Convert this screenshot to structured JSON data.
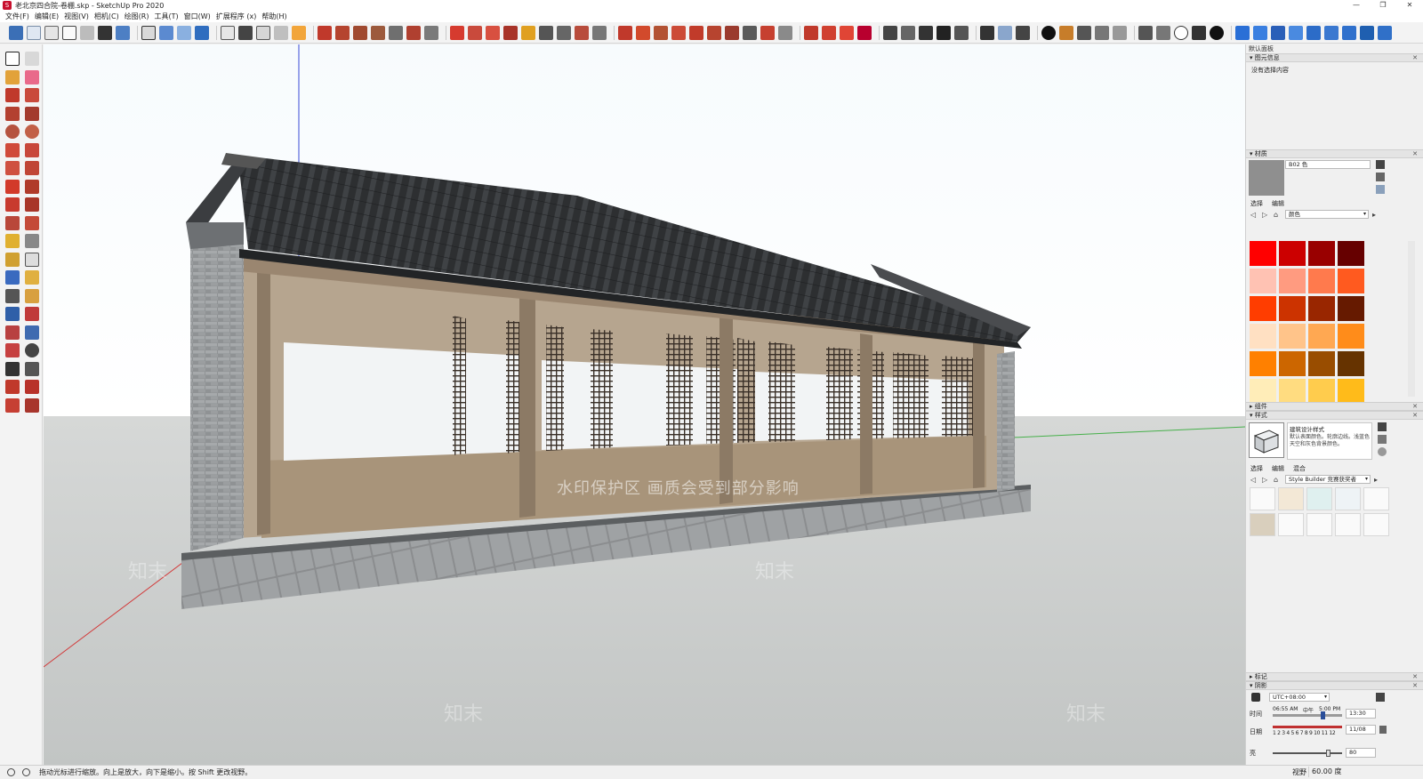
{
  "window": {
    "title": "老北京四合院-卷棚.skp - SketchUp Pro 2020",
    "controls": [
      "—",
      "❐",
      "✕"
    ]
  },
  "menu": [
    "文件(F)",
    "编辑(E)",
    "视图(V)",
    "相机(C)",
    "绘图(R)",
    "工具(T)",
    "窗口(W)",
    "扩展程序 (x)",
    "帮助(H)"
  ],
  "viewport": {
    "watermark_text": "水印保护区  画质会受到部分影响",
    "watermark_logo": "知末"
  },
  "tray": {
    "title": "默认面板",
    "entity_info": {
      "header": "图元信息",
      "message": "没有选择内容"
    },
    "materials": {
      "header": "材质",
      "current_name": "B02 色",
      "tabs": [
        "选择",
        "编辑"
      ],
      "library": "颜色",
      "swatches": [
        "#ff0000",
        "#cc0000",
        "#990000",
        "#660000",
        "#ffc2b3",
        "#ff9b80",
        "#ff7a4d",
        "#ff5a1f",
        "#ff3d00",
        "#cc3300",
        "#992600",
        "#661a00",
        "#ffe0c2",
        "#ffc48a",
        "#ffa852",
        "#ff8c1a",
        "#ff8000",
        "#cc6600",
        "#994d00",
        "#663300",
        "#ffedb8",
        "#ffdc80",
        "#ffcc4d",
        "#ffbb1a"
      ]
    },
    "components": {
      "header": "组件"
    },
    "styles": {
      "header": "样式",
      "name": "建筑设计样式",
      "description": "默认表面颜色。轮廓边线。浅蓝色天空和灰色背景颜色。",
      "tabs": [
        "选择",
        "编辑",
        "混合"
      ],
      "collection": "Style Builder 竞赛获奖者"
    },
    "tags": {
      "header": "标记"
    },
    "shadows": {
      "header": "阴影",
      "timezone": "UTC+08:00",
      "time_label": "时间",
      "time_start": "06:55 AM",
      "time_mid": "中午",
      "time_end": "5:00 PM",
      "time_value": "13:30",
      "date_label": "日期",
      "months": "1 2 3 4 5 6 7 8 9 10 11 12",
      "date_value": "11/08",
      "light_label": "亮",
      "light_value": "80"
    }
  },
  "status": {
    "hint": "拖动光标进行缩放。向上是放大，向下是缩小。按 Shift 更改视野。",
    "measurement_label": "视野",
    "measurement_value": "60.00 度"
  }
}
